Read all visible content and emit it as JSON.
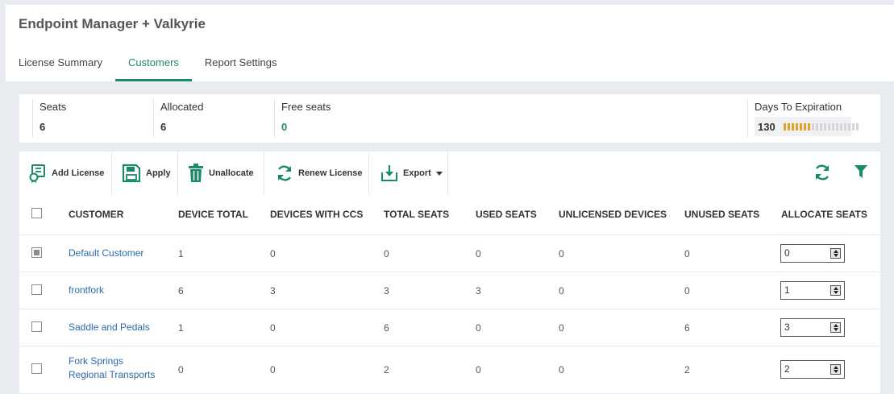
{
  "app": {
    "title": "Endpoint Manager + Valkyrie"
  },
  "tabs": [
    {
      "label": "License Summary",
      "active": false
    },
    {
      "label": "Customers",
      "active": true
    },
    {
      "label": "Report Settings",
      "active": false
    }
  ],
  "stats": {
    "seats": {
      "label": "Seats",
      "value": "6"
    },
    "allocated": {
      "label": "Allocated",
      "value": "6"
    },
    "free": {
      "label": "Free seats",
      "value": "0"
    },
    "expiration": {
      "label": "Days To Expiration",
      "value": "130",
      "progress_segments_filled": 7,
      "progress_segments_total": 19
    }
  },
  "toolbar": {
    "add_license": "Add License",
    "apply": "Apply",
    "unallocate": "Unallocate",
    "renew_license": "Renew License",
    "export": "Export",
    "icons": {
      "refresh": "refresh-icon",
      "filter": "filter-icon"
    }
  },
  "columns": [
    "CUSTOMER",
    "DEVICE TOTAL",
    "DEVICES WITH CCS",
    "TOTAL SEATS",
    "USED SEATS",
    "UNLICENSED DEVICES",
    "UNUSED SEATS",
    "ALLOCATE SEATS"
  ],
  "rows": [
    {
      "customer": "Default Customer",
      "device_total": "1",
      "devices_ccs": "0",
      "total_seats": "0",
      "used_seats": "0",
      "unlicensed": "0",
      "unused": "0",
      "allocate": "0"
    },
    {
      "customer": "frontfork",
      "device_total": "6",
      "devices_ccs": "3",
      "total_seats": "3",
      "used_seats": "3",
      "unlicensed": "0",
      "unused": "0",
      "allocate": "1"
    },
    {
      "customer": "Saddle and Pedals",
      "device_total": "1",
      "devices_ccs": "0",
      "total_seats": "6",
      "used_seats": "0",
      "unlicensed": "0",
      "unused": "6",
      "allocate": "3"
    },
    {
      "customer_line1": "Fork Springs",
      "customer_line2": "Regional Transports",
      "device_total": "0",
      "devices_ccs": "0",
      "total_seats": "2",
      "used_seats": "0",
      "unlicensed": "0",
      "unused": "2",
      "allocate": "2"
    }
  ],
  "colors": {
    "accent": "#1a8a6a",
    "link": "#2c6aa8",
    "progress": "#e3a224"
  }
}
